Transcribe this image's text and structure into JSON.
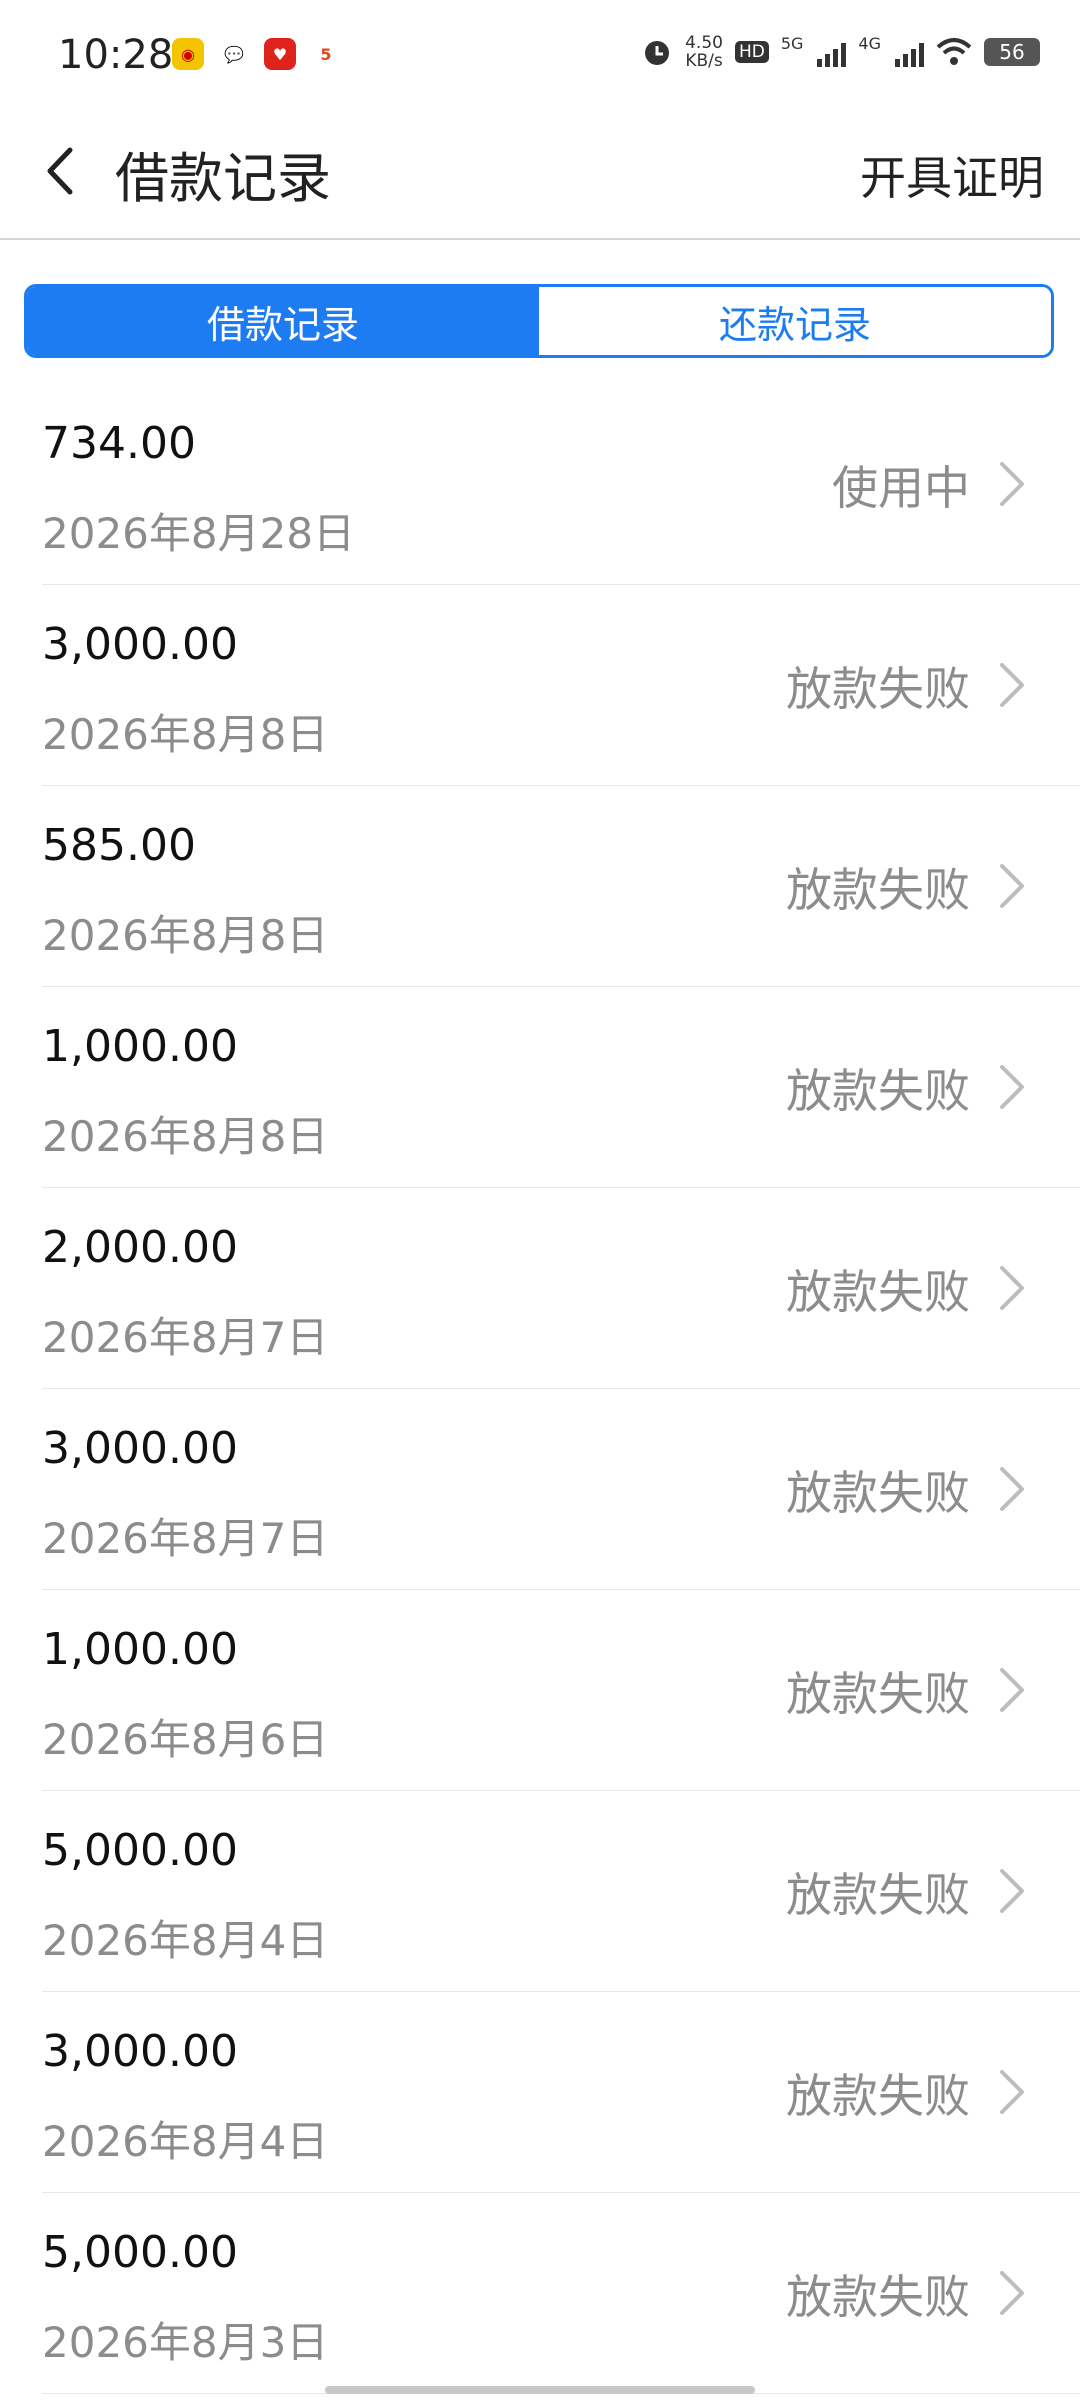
{
  "status_bar": {
    "time": "10:28",
    "net_speed_value": "4.50",
    "net_speed_unit": "KB/s",
    "hd_label": "HD",
    "sim1_label": "5G",
    "sim2_label": "4G",
    "battery": "56",
    "app_icons": [
      "weibo-icon",
      "wechat-icon",
      "pinduoduo-icon",
      "58-icon"
    ]
  },
  "header": {
    "title": "借款记录",
    "action_label": "开具证明"
  },
  "tabs": [
    {
      "label": "借款记录",
      "active": true
    },
    {
      "label": "还款记录",
      "active": false
    }
  ],
  "records": [
    {
      "amount": "734.00",
      "date": "2026年8月28日",
      "status": "使用中"
    },
    {
      "amount": "3,000.00",
      "date": "2026年8月8日",
      "status": "放款失败"
    },
    {
      "amount": "585.00",
      "date": "2026年8月8日",
      "status": "放款失败"
    },
    {
      "amount": "1,000.00",
      "date": "2026年8月8日",
      "status": "放款失败"
    },
    {
      "amount": "2,000.00",
      "date": "2026年8月7日",
      "status": "放款失败"
    },
    {
      "amount": "3,000.00",
      "date": "2026年8月7日",
      "status": "放款失败"
    },
    {
      "amount": "1,000.00",
      "date": "2026年8月6日",
      "status": "放款失败"
    },
    {
      "amount": "5,000.00",
      "date": "2026年8月4日",
      "status": "放款失败"
    },
    {
      "amount": "3,000.00",
      "date": "2026年8月4日",
      "status": "放款失败"
    },
    {
      "amount": "5,000.00",
      "date": "2026年8月3日",
      "status": "放款失败"
    }
  ],
  "colors": {
    "accent": "#1e7cf2",
    "secondary_text": "#8c8c8c"
  }
}
